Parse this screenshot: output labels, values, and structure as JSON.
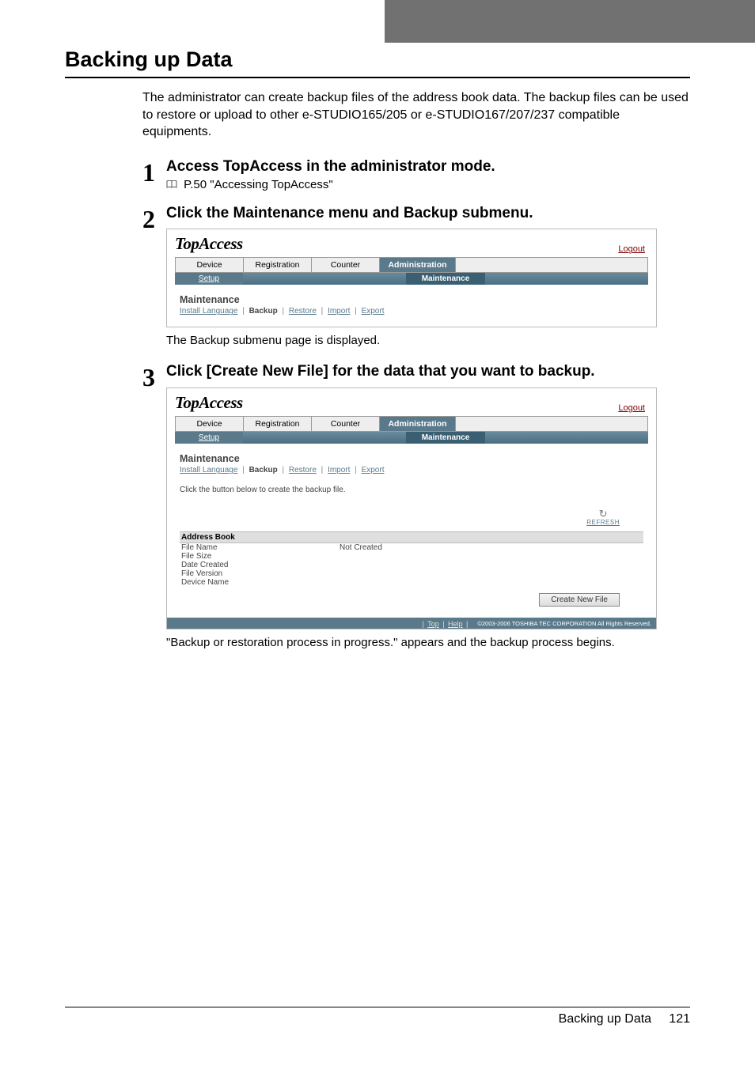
{
  "section_heading": "Backing up Data",
  "intro_para": "The administrator can create backup files of the address book data. The backup files can be used to restore or upload to other e-STUDIO165/205 or e-STUDIO167/207/237 compatible equipments.",
  "step1": {
    "num": "1",
    "heading": "Access TopAccess in the administrator mode.",
    "ref": "P.50 \"Accessing TopAccess\""
  },
  "step2": {
    "num": "2",
    "heading": "Click the Maintenance menu and Backup submenu.",
    "caption_after": "The Backup submenu page is displayed."
  },
  "step3": {
    "num": "3",
    "heading": "Click [Create New File] for the data that you want to backup.",
    "caption_after": "\"Backup or restoration process in progress.\" appears and the backup process begins."
  },
  "ta": {
    "logo": "TopAccess",
    "logout": "Logout",
    "tabs": [
      "Device",
      "Registration",
      "Counter",
      "Administration"
    ],
    "subtabs": {
      "setup": "Setup",
      "maintenance": "Maintenance"
    },
    "maint_title": "Maintenance",
    "sublinks": {
      "install": "Install Language",
      "backup": "Backup",
      "restore": "Restore",
      "import": "Import",
      "export": "Export"
    },
    "hint": "Click the button below to create the backup file.",
    "refresh": "REFRESH",
    "address_book_header": "Address Book",
    "rows": {
      "file_name_label": "File Name",
      "file_name_value": "Not Created",
      "file_size_label": "File Size",
      "date_created_label": "Date Created",
      "file_version_label": "File Version",
      "device_name_label": "Device Name"
    },
    "create_btn": "Create New File",
    "bottom_top": "Top",
    "bottom_help": "Help",
    "copyright": "©2003-2006 TOSHIBA TEC CORPORATION All Rights Reserved."
  },
  "footer": {
    "label": "Backing up Data",
    "page": "121"
  }
}
